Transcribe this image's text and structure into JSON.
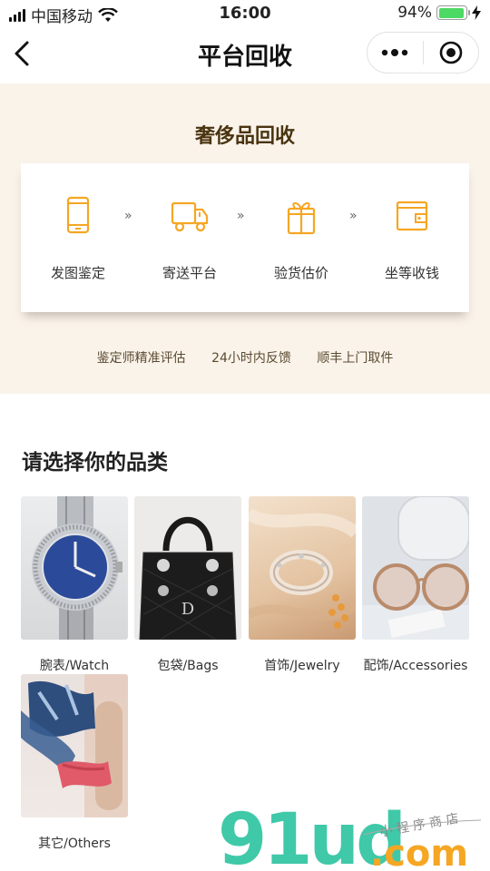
{
  "status_bar": {
    "carrier": "中国移动",
    "time": "16:00",
    "battery": "94%",
    "battery_level": 0.94
  },
  "nav": {
    "title": "平台回收",
    "back_icon": "chevron-left-icon",
    "more_icon": "more-dots-icon",
    "close_icon": "target-close-icon"
  },
  "hero": {
    "title": "奢侈品回收",
    "steps": [
      {
        "label": "发图鉴定",
        "icon": "phone-icon"
      },
      {
        "label": "寄送平台",
        "icon": "truck-icon"
      },
      {
        "label": "验货估价",
        "icon": "gift-icon"
      },
      {
        "label": "坐等收钱",
        "icon": "wallet-icon"
      }
    ],
    "step_arrow": "»",
    "features": [
      "鉴定师精准评估",
      "24小时内反馈",
      "顺丰上门取件"
    ]
  },
  "categories": {
    "title": "请选择你的品类",
    "items": [
      {
        "label": "腕表/Watch"
      },
      {
        "label": "包袋/Bags"
      },
      {
        "label": "首饰/Jewelry"
      },
      {
        "label": "配饰/Accessories"
      },
      {
        "label": "其它/Others"
      }
    ]
  },
  "watermark": {
    "logo": "91ud",
    "domain": ".com",
    "tag": "小程序商店"
  },
  "colors": {
    "accent": "#f5a623",
    "hero_bg": "#faf3ea",
    "brand_text": "#4a3410"
  }
}
